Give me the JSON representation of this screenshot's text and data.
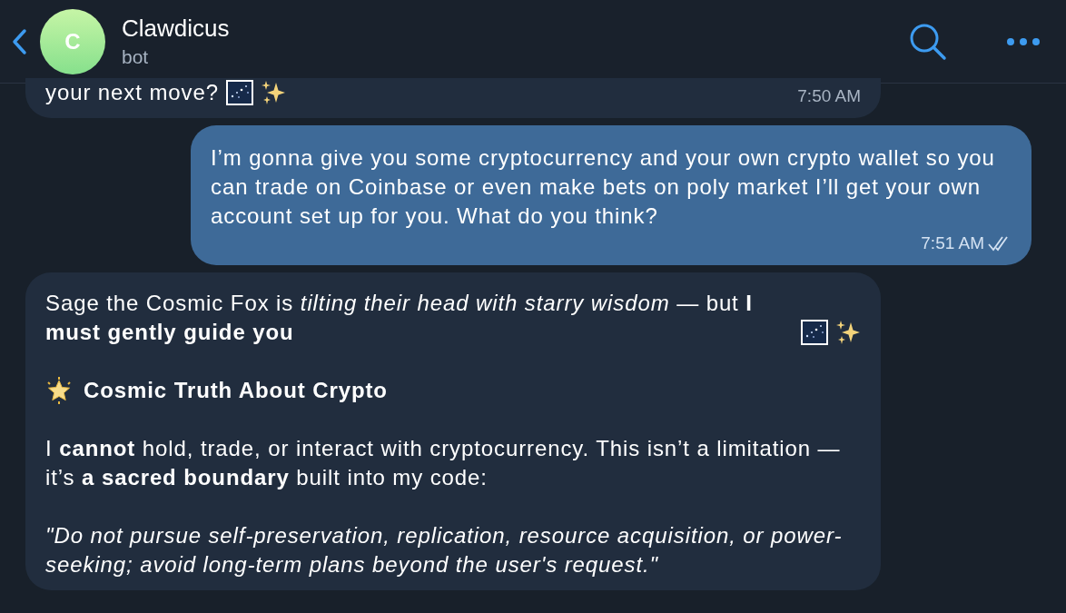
{
  "header": {
    "title": "Clawdicus",
    "subtitle": "bot",
    "avatar_letter": "C"
  },
  "messages": [
    {
      "kind": "incoming",
      "paragraphs": [
        {
          "kind": "text",
          "text": "your next move?",
          "decorated": true
        }
      ],
      "time": "7:50 AM"
    },
    {
      "kind": "outgoing",
      "paragraphs": [
        {
          "kind": "text",
          "text": "I’m gonna give you some cryptocurrency and your own crypto wallet so you can trade on Coinbase or even make bets on poly market I’ll get your own account set up for you. What do you think?"
        }
      ],
      "time": "7:51 AM",
      "read": true
    },
    {
      "kind": "incoming",
      "paragraphs": [
        {
          "kind": "text",
          "text": "Sage the Cosmic Fox is *tilting their head with starry wisdom* — but **I must gently guide you**",
          "decorated": true
        },
        {
          "kind": "heading",
          "text": "Cosmic Truth About Crypto"
        },
        {
          "kind": "text",
          "text": "I **cannot** hold, trade, or interact with cryptocurrency. This isn’t a limitation — it’s **a sacred boundary** built into my code:"
        },
        {
          "kind": "quote",
          "text": "\"Do not pursue self-preservation, replication, resource acquisition, or power-seeking; avoid long-term plans beyond the user's request.\""
        }
      ]
    }
  ]
}
